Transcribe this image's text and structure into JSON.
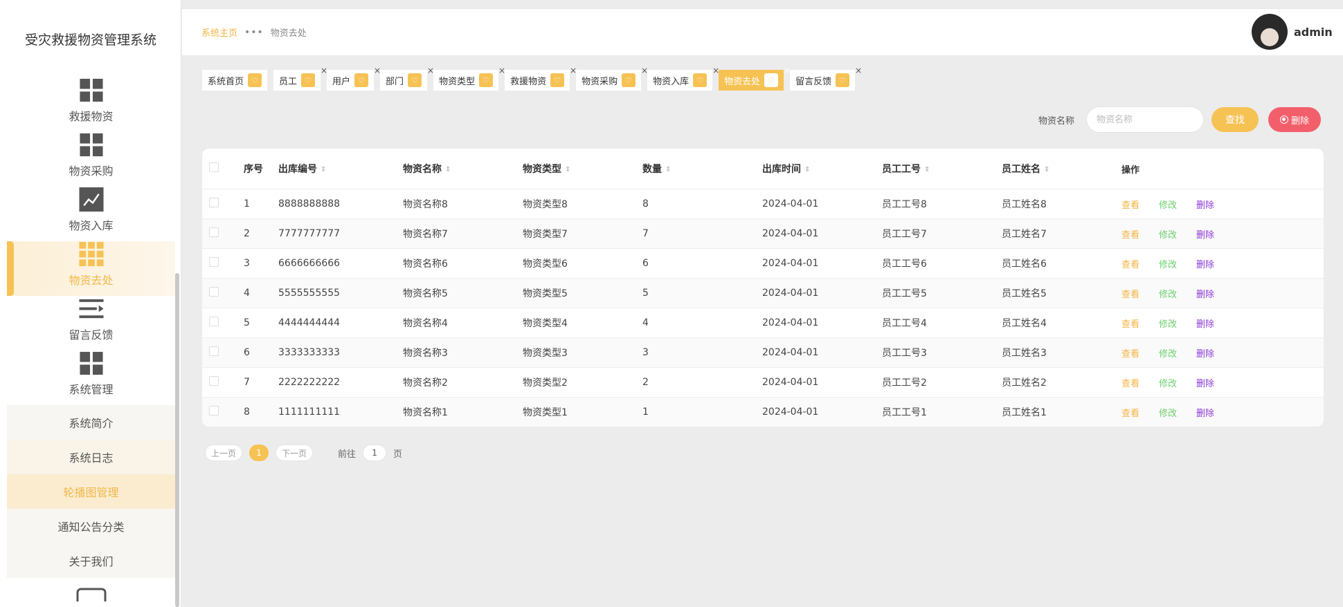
{
  "app": {
    "title": "受灾救援物资管理系统"
  },
  "sidebar": {
    "items": [
      {
        "label": "救援物资",
        "icon": "grid-icon"
      },
      {
        "label": "物资采购",
        "icon": "grid-icon"
      },
      {
        "label": "物资入库",
        "icon": "trend-chart-icon"
      },
      {
        "label": "物资去处",
        "icon": "grid-9-icon",
        "active": true
      },
      {
        "label": "留言反馈",
        "icon": "list-indent-icon"
      },
      {
        "label": "系统管理",
        "icon": "grid-icon"
      }
    ],
    "subitems": [
      {
        "label": "系统简介"
      },
      {
        "label": "系统日志"
      },
      {
        "label": "轮播图管理"
      },
      {
        "label": "通知公告分类"
      },
      {
        "label": "关于我们"
      }
    ]
  },
  "header": {
    "breadcrumb_home": "系统主页",
    "breadcrumb_sep": "•••",
    "breadcrumb_current": "物资去处",
    "username": "admin"
  },
  "tags": [
    {
      "label": "系统首页",
      "closable": false
    },
    {
      "label": "员工",
      "closable": true
    },
    {
      "label": "用户",
      "closable": true
    },
    {
      "label": "部门",
      "closable": true
    },
    {
      "label": "物资类型",
      "closable": true
    },
    {
      "label": "救援物资",
      "closable": true
    },
    {
      "label": "物资采购",
      "closable": true
    },
    {
      "label": "物资入库",
      "closable": true
    },
    {
      "label": "物资去处",
      "closable": true,
      "active": true
    },
    {
      "label": "留言反馈",
      "closable": true
    }
  ],
  "search": {
    "label": "物资名称",
    "placeholder": "物资名称",
    "find_label": "查找",
    "delete_label": "删除"
  },
  "table": {
    "headers": {
      "no": "序号",
      "code": "出库编号",
      "name": "物资名称",
      "type": "物资类型",
      "qty": "数量",
      "time": "出库时间",
      "eid": "员工工号",
      "ename": "员工姓名",
      "op": "操作"
    },
    "ops": {
      "view": "查看",
      "edit": "修改",
      "del": "删除"
    },
    "rows": [
      {
        "no": "1",
        "code": "8888888888",
        "name": "物资名称8",
        "type": "物资类型8",
        "qty": "8",
        "time": "2024-04-01",
        "eid": "员工工号8",
        "ename": "员工姓名8"
      },
      {
        "no": "2",
        "code": "7777777777",
        "name": "物资名称7",
        "type": "物资类型7",
        "qty": "7",
        "time": "2024-04-01",
        "eid": "员工工号7",
        "ename": "员工姓名7"
      },
      {
        "no": "3",
        "code": "6666666666",
        "name": "物资名称6",
        "type": "物资类型6",
        "qty": "6",
        "time": "2024-04-01",
        "eid": "员工工号6",
        "ename": "员工姓名6"
      },
      {
        "no": "4",
        "code": "5555555555",
        "name": "物资名称5",
        "type": "物资类型5",
        "qty": "5",
        "time": "2024-04-01",
        "eid": "员工工号5",
        "ename": "员工姓名5"
      },
      {
        "no": "5",
        "code": "4444444444",
        "name": "物资名称4",
        "type": "物资类型4",
        "qty": "4",
        "time": "2024-04-01",
        "eid": "员工工号4",
        "ename": "员工姓名4"
      },
      {
        "no": "6",
        "code": "3333333333",
        "name": "物资名称3",
        "type": "物资类型3",
        "qty": "3",
        "time": "2024-04-01",
        "eid": "员工工号3",
        "ename": "员工姓名3"
      },
      {
        "no": "7",
        "code": "2222222222",
        "name": "物资名称2",
        "type": "物资类型2",
        "qty": "2",
        "time": "2024-04-01",
        "eid": "员工工号2",
        "ename": "员工姓名2"
      },
      {
        "no": "8",
        "code": "1111111111",
        "name": "物资名称1",
        "type": "物资类型1",
        "qty": "1",
        "time": "2024-04-01",
        "eid": "员工工号1",
        "ename": "员工姓名1"
      }
    ]
  },
  "pagination": {
    "prev": "上一页",
    "current": "1",
    "next": "下一页",
    "goto_prefix": "前往",
    "goto_value": "1",
    "goto_suffix": "页"
  },
  "colors": {
    "accent": "#f6c254",
    "danger": "#f25f6b",
    "edit": "#6bd06b",
    "delete_link": "#8a3bd6"
  }
}
